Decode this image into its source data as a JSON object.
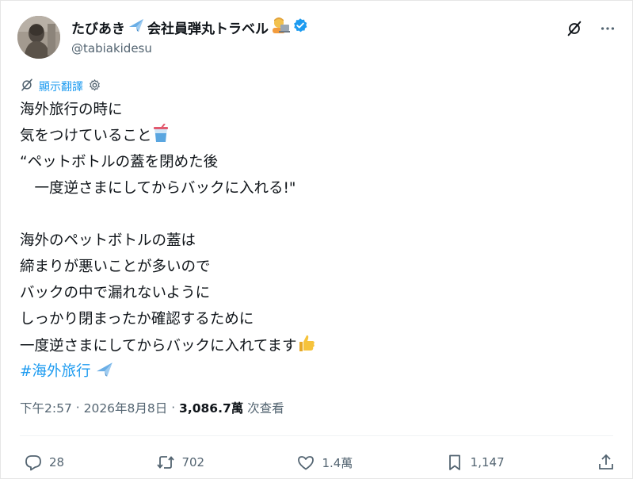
{
  "author": {
    "display_name": "たびあき",
    "display_name_suffix": "会社員弾丸トラベル",
    "handle": "@tabiakidesu",
    "verified": true
  },
  "icons": {
    "avatar": "avatar-photo",
    "plane": "airplane-emoji",
    "worker": "technologist-emoji",
    "verified": "verified-badge-icon",
    "grok": "grok-icon",
    "more": "more-icon",
    "translate": "translate-icon",
    "settings": "gear-icon",
    "drink": "cup-with-straw-emoji",
    "thumbs": "thumbs-up-emoji",
    "reply": "reply-icon",
    "retweet": "retweet-icon",
    "like": "heart-icon",
    "bookmark": "bookmark-icon",
    "share": "share-icon"
  },
  "colors": {
    "accent": "#1d9bf0",
    "text": "#0f1419",
    "muted": "#536471"
  },
  "translate_label": "顯示翻譯",
  "tweet": {
    "lines": [
      "海外旅行の時に",
      "気をつけていること",
      "“ペットボトルの蓋を閉めた後",
      "　一度逆さまにしてからバックに入れる!\"",
      "",
      "海外のペットボトルの蓋は",
      "締まりが悪いことが多いので",
      "バックの中で漏れないように",
      "しっかり閉まったか確認するために",
      "一度逆さまにしてからバックに入れてます"
    ],
    "hashtag": "#海外旅行"
  },
  "meta": {
    "time": "下午2:57",
    "separator": " · ",
    "date": "2026年8月8日",
    "views_count": "3,086.7萬",
    "views_label": " 次查看"
  },
  "actions": {
    "replies": "28",
    "retweets": "702",
    "likes": "1.4萬",
    "bookmarks": "1,147"
  }
}
